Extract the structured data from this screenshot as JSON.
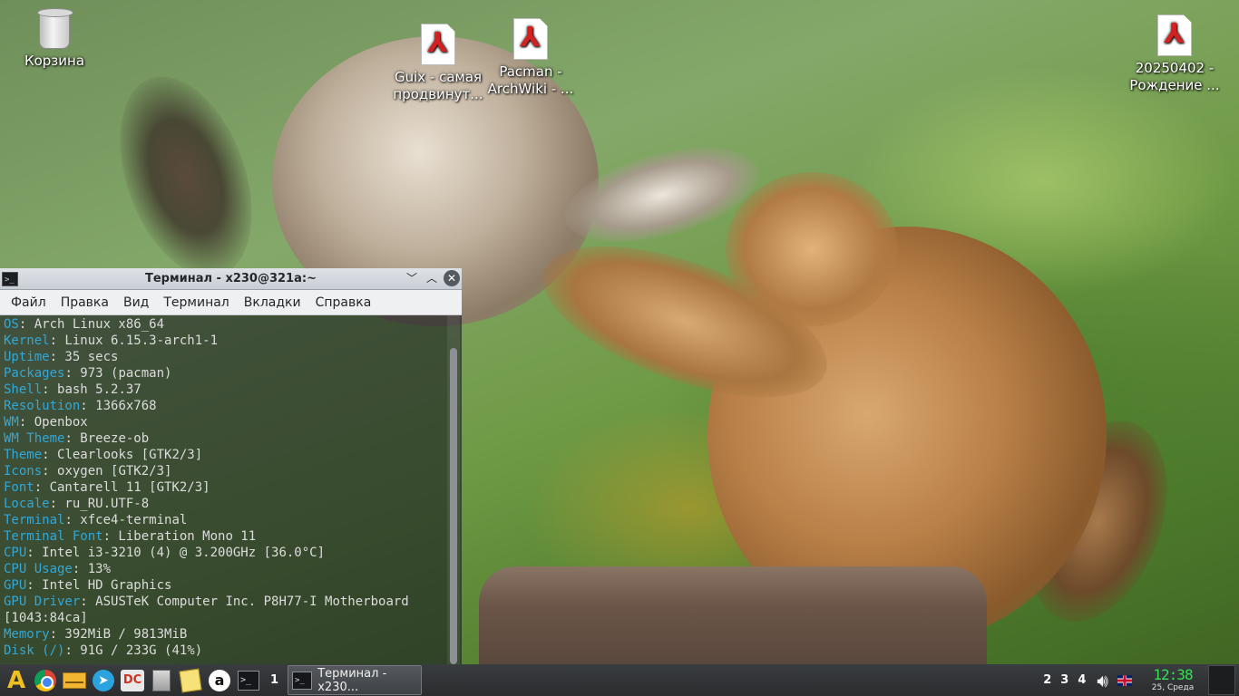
{
  "desktop": {
    "icons": [
      {
        "label": "Корзина",
        "icon": "trash-icon"
      },
      {
        "label": "Guix - самая продвинут...",
        "icon": "pdf-icon"
      },
      {
        "label": "Pacman - ArchWiki - ...",
        "icon": "pdf-icon"
      },
      {
        "label": "20250402 - Рождение ...",
        "icon": "pdf-icon"
      }
    ]
  },
  "terminal": {
    "title": "Терминал - x230@321a:~",
    "menu": [
      "Файл",
      "Правка",
      "Вид",
      "Терминал",
      "Вкладки",
      "Справка"
    ],
    "key_color": "#31a8d8",
    "lines": [
      {
        "key": "OS",
        "value": ": Arch Linux x86_64"
      },
      {
        "key": "Kernel",
        "value": ": Linux 6.15.3-arch1-1"
      },
      {
        "key": "Uptime",
        "value": ": 35 secs"
      },
      {
        "key": "Packages",
        "value": ": 973 (pacman)"
      },
      {
        "key": "Shell",
        "value": ": bash 5.2.37"
      },
      {
        "key": "Resolution",
        "value": ": 1366x768"
      },
      {
        "key": "WM",
        "value": ": Openbox"
      },
      {
        "key": "WM Theme",
        "value": ": Breeze-ob"
      },
      {
        "key": "Theme",
        "value": ": Clearlooks [GTK2/3]"
      },
      {
        "key": "Icons",
        "value": ": oxygen [GTK2/3]"
      },
      {
        "key": "Font",
        "value": ": Cantarell 11 [GTK2/3]"
      },
      {
        "key": "Locale",
        "value": ": ru_RU.UTF-8"
      },
      {
        "key": "Terminal",
        "value": ": xfce4-terminal"
      },
      {
        "key": "Terminal Font",
        "value": ": Liberation Mono 11"
      },
      {
        "key": "CPU",
        "value": ": Intel i3-3210 (4) @ 3.200GHz [36.0°C]"
      },
      {
        "key": "CPU Usage",
        "value": ": 13%"
      },
      {
        "key": "GPU",
        "value": ": Intel HD Graphics"
      },
      {
        "key": "GPU Driver",
        "value": ": ASUSTeK Computer Inc. P8H77-I Motherboard"
      },
      {
        "key": "",
        "value": "[1043:84ca]"
      },
      {
        "key": "Memory",
        "value": ": 392MiB / 9813MiB"
      },
      {
        "key": "Disk (/)",
        "value": ": 91G / 233G (41%)"
      }
    ]
  },
  "taskbar": {
    "launchers": [
      {
        "name": "arch-menu",
        "glyph": "A"
      },
      {
        "name": "chromium",
        "glyph": ""
      },
      {
        "name": "mail",
        "glyph": ""
      },
      {
        "name": "telegram",
        "glyph": "➤"
      },
      {
        "name": "double-commander",
        "glyph": "DC"
      },
      {
        "name": "file-manager",
        "glyph": ""
      },
      {
        "name": "notes",
        "glyph": ""
      },
      {
        "name": "anon-app",
        "glyph": "a"
      },
      {
        "name": "terminal",
        "glyph": ">_"
      }
    ],
    "current_workspace": "1",
    "task_label": "Терминал - x230...",
    "workspaces": [
      "2",
      "3",
      "4"
    ],
    "clock_time": "12:38",
    "clock_date": "25, Среда"
  }
}
